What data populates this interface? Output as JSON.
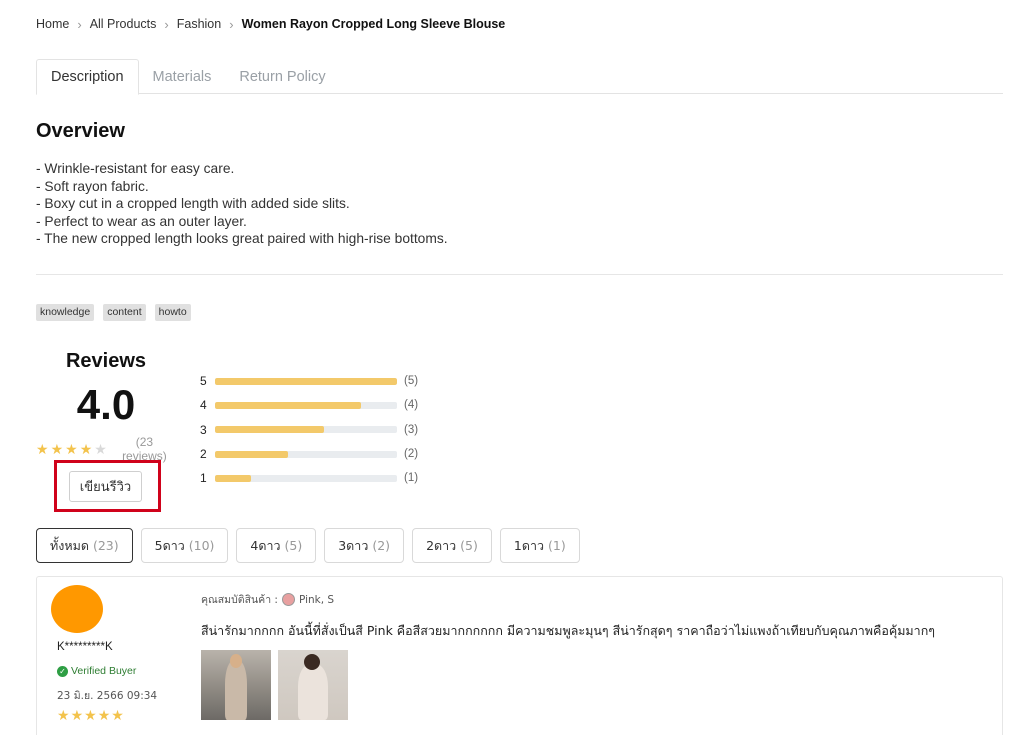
{
  "breadcrumb": {
    "items": [
      "Home",
      "All Products",
      "Fashion"
    ],
    "current": "Women Rayon Cropped Long Sleeve Blouse"
  },
  "tabs": [
    {
      "label": "Description",
      "active": true
    },
    {
      "label": "Materials",
      "active": false
    },
    {
      "label": "Return Policy",
      "active": false
    }
  ],
  "overview": {
    "title": "Overview",
    "points": [
      "- Wrinkle-resistant for easy care.",
      "- Soft rayon fabric.",
      "- Boxy cut in a cropped length with added side slits.",
      "- Perfect to wear as an outer layer.",
      "- The new cropped length looks great paired with high-rise bottoms."
    ]
  },
  "tags": [
    "knowledge",
    "content",
    "howto"
  ],
  "reviews": {
    "title": "Reviews",
    "average": "4.0",
    "stars_filled": 4,
    "count_label": "(23 reviews)",
    "write_label": "เขียนรีวิว",
    "distribution": [
      {
        "star": "5",
        "count": "(5)",
        "fill": 1.0
      },
      {
        "star": "4",
        "count": "(4)",
        "fill": 0.8
      },
      {
        "star": "3",
        "count": "(3)",
        "fill": 0.6
      },
      {
        "star": "2",
        "count": "(2)",
        "fill": 0.4
      },
      {
        "star": "1",
        "count": "(1)",
        "fill": 0.2
      }
    ],
    "filters": [
      {
        "label": "ทั้งหมด",
        "count": "(23)",
        "active": true
      },
      {
        "label": "5ดาว",
        "count": "(10)",
        "active": false
      },
      {
        "label": "4ดาว",
        "count": "(5)",
        "active": false
      },
      {
        "label": "3ดาว",
        "count": "(2)",
        "active": false
      },
      {
        "label": "2ดาว",
        "count": "(5)",
        "active": false
      },
      {
        "label": "1ดาว",
        "count": "(1)",
        "active": false
      }
    ]
  },
  "review_item": {
    "name": "K*********K",
    "verified_label": "Verified Buyer",
    "date": "23 มิ.ย. 2566 09:34",
    "stars": 5,
    "attribute_label": "คุณสมบัติสินค้า :",
    "attribute_value": "Pink, S",
    "swatch_color": "#e8a0a0",
    "text": "สีน่ารักมากกกก อันนี้ที่สั่งเป็นสี Pink คือสีสวยมากกกกกก มีความชมพูละมุนๆ สีน่ารักสุดๆ ราคาถือว่าไม่แพงถ้าเทียบกับคุณภาพคือคุ้มมากๆ"
  },
  "colors": {
    "star": "#f3c34c",
    "bar": "#f3c96a",
    "highlight": "#d0021b",
    "avatar": "#ff9800",
    "verified": "#2e7d32"
  }
}
